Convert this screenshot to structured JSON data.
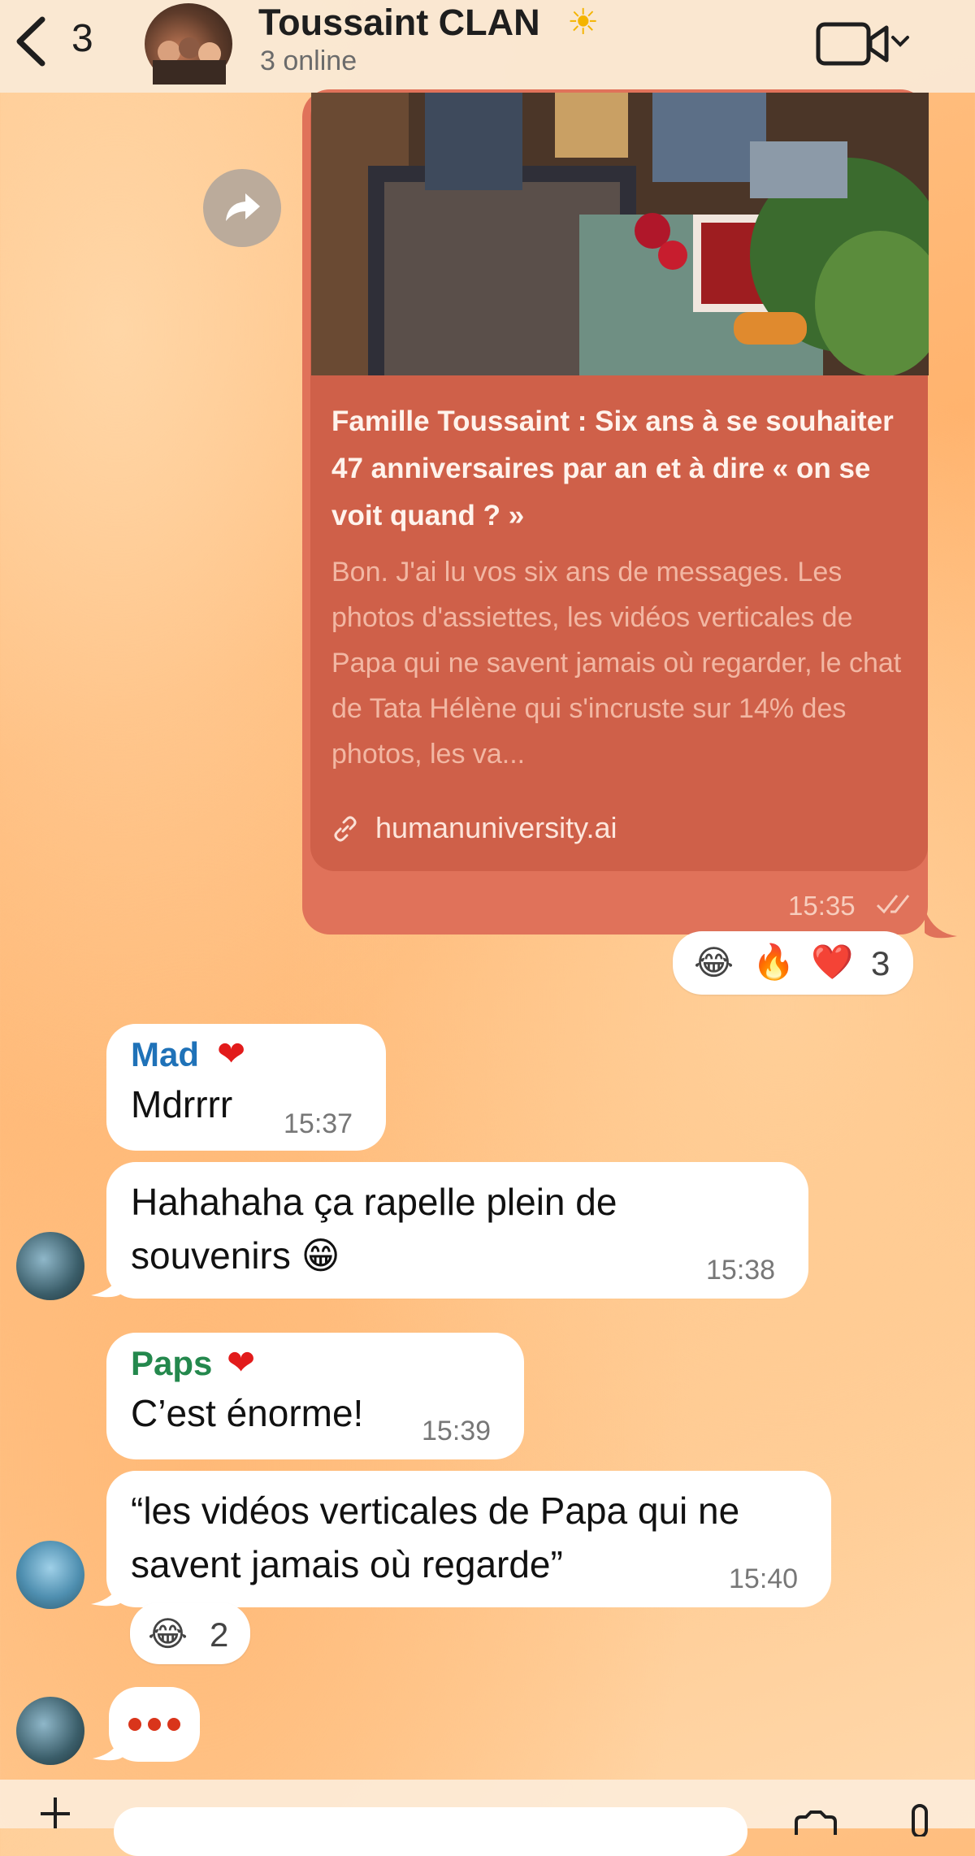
{
  "header": {
    "back_count": "3",
    "title": "Toussaint CLAN",
    "title_emoji": "☀",
    "subtitle": "3 online"
  },
  "shared_link": {
    "title": "Famille Toussaint : Six ans à se souhaiter 47 anniversaires par an et à dire « on se voit quand ? »",
    "description": "Bon. J'ai lu vos six ans de messages. Les photos d'assiettes, les vidéos verticales de Papa qui ne savent jamais où regarder, le chat de Tata Hélène qui s'incruste sur 14% des photos, les va...",
    "url": "humanuniversity.ai",
    "time": "15:35",
    "reactions": {
      "emojis": [
        "😂",
        "🔥",
        "❤️"
      ],
      "count": "3"
    }
  },
  "messages": [
    {
      "sender": "Mad",
      "sender_emoji": "❤",
      "text": "Mdrrrr",
      "time": "15:37"
    },
    {
      "text_line1": "Hahahaha ça rapelle plein de",
      "text_line2": "souvenirs 😁",
      "time": "15:38"
    },
    {
      "sender": "Paps",
      "sender_emoji": "❤",
      "text": "C’est énorme!",
      "time": "15:39"
    },
    {
      "text_line1": "“les vidéos verticales de Papa qui ne",
      "text_line2": "savent jamais où regarde”",
      "time": "15:40",
      "reactions": {
        "emoji": "😂",
        "count": "2"
      }
    }
  ],
  "colors": {
    "link_bubble": "#e0725a",
    "link_card": "#cf6049",
    "sender_mad": "#1f72b8",
    "sender_paps": "#24884d",
    "typing_dots": "#d9351b"
  },
  "icons": [
    "back-chevron-icon",
    "video-call-icon",
    "chevron-down-icon",
    "forward-icon",
    "link-icon",
    "double-check-icon",
    "typing-indicator-icon"
  ]
}
